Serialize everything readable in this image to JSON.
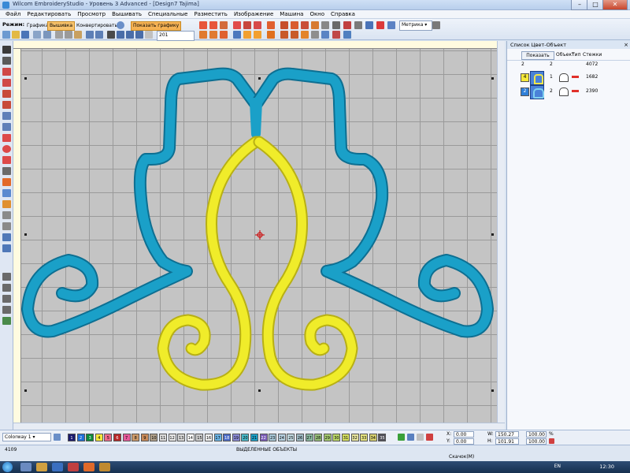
{
  "window": {
    "title": "Wilcom EmbroideryStudio - Уровень 3 Advanced - [Design7     Tajima]",
    "minimize": "–",
    "maximize": "□",
    "close": "✕"
  },
  "menu": [
    "Файл",
    "Редактировать",
    "Просмотр",
    "Вышивать",
    "Специальные",
    "Разместить",
    "Изображение",
    "Машина",
    "Окно",
    "Справка"
  ],
  "toolbar": {
    "mode_label": "Режим:",
    "graphics": "Графика",
    "embroidery": "Вышивка",
    "convert": "Конвертировать",
    "show_graphics": "Показать графику",
    "zoom_value": "201",
    "units": "Метрика"
  },
  "colors": {
    "thread_blue": "#1aa0c8",
    "thread_yellow": "#f0ec2a",
    "canvas": "#c4c4c4",
    "active_button": "#f8c36c"
  },
  "panel": {
    "title": "Список Цвет-Объект",
    "close": "×",
    "show_button": "Показать",
    "col_object": "Объект",
    "col_type": "Тип",
    "col_stitches": "Стежки",
    "summary": {
      "a": "2",
      "b": "2",
      "stitches": "4072"
    },
    "rows": [
      {
        "index": "1",
        "color_index": "4",
        "stitches": "1682",
        "swatch": "#f0e64a",
        "icon": "yellow-design-thumbnail"
      },
      {
        "index": "2",
        "color_index": "2",
        "stitches": "2390",
        "swatch": "#2f7fd8",
        "icon": "blue-design-thumbnail"
      }
    ]
  },
  "colorbar": {
    "colorway": "Colorway 1",
    "swatches": [
      {
        "n": "1",
        "c": "#1a1a6e"
      },
      {
        "n": "2",
        "c": "#1e6fd9"
      },
      {
        "n": "3",
        "c": "#0a8a3a"
      },
      {
        "n": "4",
        "c": "#f6e93a"
      },
      {
        "n": "5",
        "c": "#ef6a8a"
      },
      {
        "n": "6",
        "c": "#b82828"
      },
      {
        "n": "7",
        "c": "#e65a9a"
      },
      {
        "n": "8",
        "c": "#cc9a6a"
      },
      {
        "n": "9",
        "c": "#c88a5a"
      },
      {
        "n": "10",
        "c": "#b0a08a"
      },
      {
        "n": "11",
        "c": "#dcdcdc"
      },
      {
        "n": "12",
        "c": "#e8e8e8"
      },
      {
        "n": "13",
        "c": "#d7d7d7"
      },
      {
        "n": "14",
        "c": "#ffffff"
      },
      {
        "n": "15",
        "c": "#cfcfcf"
      },
      {
        "n": "16",
        "c": "#f2f2f2"
      },
      {
        "n": "17",
        "c": "#6ab4e6"
      },
      {
        "n": "18",
        "c": "#4c6cc8"
      },
      {
        "n": "19",
        "c": "#8a8ad6"
      },
      {
        "n": "20",
        "c": "#49b9c9"
      },
      {
        "n": "21",
        "c": "#1aa0c8"
      },
      {
        "n": "22",
        "c": "#7a5cb8"
      },
      {
        "n": "23",
        "c": "#a8c8d8"
      },
      {
        "n": "24",
        "c": "#b6d0e0"
      },
      {
        "n": "25",
        "c": "#c0d8e0"
      },
      {
        "n": "26",
        "c": "#a0bcc6"
      },
      {
        "n": "27",
        "c": "#8ab8a0"
      },
      {
        "n": "28",
        "c": "#98c07a"
      },
      {
        "n": "29",
        "c": "#a6cc70"
      },
      {
        "n": "30",
        "c": "#bcd868"
      },
      {
        "n": "31",
        "c": "#d6e060"
      },
      {
        "n": "32",
        "c": "#e8e6a0"
      },
      {
        "n": "33",
        "c": "#e6e480"
      },
      {
        "n": "34",
        "c": "#d6d070"
      },
      {
        "n": "35",
        "c": "#50505a"
      }
    ],
    "x_label": "X:",
    "x_value": "0.00",
    "y_label": "Y:",
    "y_value": "0.00",
    "w_label": "W:",
    "w_value": "150.27",
    "w_pct": "100.00",
    "h_label": "H:",
    "h_value": "101.91",
    "h_pct": "100.00",
    "pct": "%"
  },
  "status": {
    "stitch_count": "4109",
    "selected_objects": "ВЫДЕЛЕННЫЕ ОБЪЕКТЫ",
    "jumps": "Скачок(M)"
  },
  "taskbar": {
    "lang": "EN",
    "clock": "12:30"
  }
}
